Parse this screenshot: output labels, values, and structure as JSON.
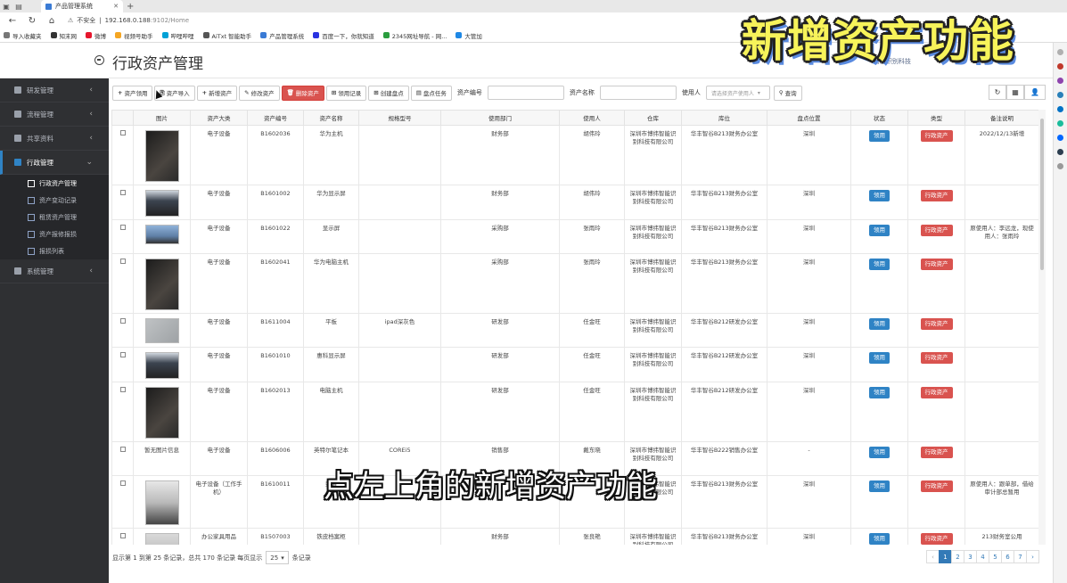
{
  "browser": {
    "tab_title": "产品管理系统",
    "address_warning": "不安全",
    "address_host": "192.168.0.188",
    "address_path": ":9102/Home",
    "bookmarks": [
      "导入收藏夹",
      "知末网",
      "微博",
      "视频号助手",
      "哔哩哔哩",
      "AiTxt 智能助手",
      "产品管理系统",
      "百度一下，你就知道",
      "2345网址导航 - 网...",
      "大管加"
    ]
  },
  "header": {
    "title": "行政资产管理",
    "company": "智能识别科技"
  },
  "sidebar": {
    "items": [
      {
        "label": "研发管理"
      },
      {
        "label": "流程管理"
      },
      {
        "label": "共享资料"
      },
      {
        "label": "行政管理"
      }
    ],
    "sub_items": [
      {
        "label": "行政资产管理"
      },
      {
        "label": "资产变动记录"
      },
      {
        "label": "租赁资产管理"
      },
      {
        "label": "资产报修报损"
      },
      {
        "label": "报损列表"
      }
    ],
    "last_item": {
      "label": "系统管理"
    }
  },
  "toolbar": {
    "buttons": [
      "资产领用",
      "资产导入",
      "新增资产",
      "修改资产",
      "删除资产",
      "领用记录",
      "创建盘点",
      "盘点任务"
    ],
    "label_code": "资产编号",
    "label_name": "资产名称",
    "label_user": "使用人",
    "user_placeholder": "请选择资产使用人",
    "query": "查询"
  },
  "table": {
    "headers": [
      "",
      "图片",
      "资产大类",
      "资产编号",
      "资产名称",
      "规格型号",
      "使用部门",
      "使用人",
      "仓库",
      "库位",
      "盘点位置",
      "状态",
      "类型",
      "备注说明"
    ],
    "rows": [
      {
        "img": "",
        "category": "电子设备",
        "code": "B1602036",
        "name": "华为主机",
        "spec": "",
        "dept": "财务部",
        "user": "胡伟玲",
        "warehouse": "深圳市博纬智能识别科技有限公司",
        "location": "华丰智谷B213财务办公室",
        "check": "深圳",
        "status": "领用",
        "type": "行政资产",
        "note": "2022/12/13新增"
      },
      {
        "img": "",
        "category": "电子设备",
        "code": "B1601002",
        "name": "华为显示屏",
        "spec": "",
        "dept": "财务部",
        "user": "胡伟玲",
        "warehouse": "深圳市博纬智能识别科技有限公司",
        "location": "华丰智谷B213财务办公室",
        "check": "深圳",
        "status": "领用",
        "type": "行政资产",
        "note": ""
      },
      {
        "img": "",
        "category": "电子设备",
        "code": "B1601022",
        "name": "显示屏",
        "spec": "",
        "dept": "采购部",
        "user": "张雨玲",
        "warehouse": "深圳市博纬智能识别科技有限公司",
        "location": "华丰智谷B213财务办公室",
        "check": "深圳",
        "status": "领用",
        "type": "行政资产",
        "note": "原使用人：李远龙，现使用人：张雨玲"
      },
      {
        "img": "",
        "category": "电子设备",
        "code": "B1602041",
        "name": "华为电脑主机",
        "spec": "",
        "dept": "采购部",
        "user": "张雨玲",
        "warehouse": "深圳市博纬智能识别科技有限公司",
        "location": "华丰智谷B213财务办公室",
        "check": "深圳",
        "status": "领用",
        "type": "行政资产",
        "note": ""
      },
      {
        "img": "",
        "category": "电子设备",
        "code": "B1611004",
        "name": "平板",
        "spec": "ipad深灰色",
        "dept": "研发部",
        "user": "任金旺",
        "warehouse": "深圳市博纬智能识别科技有限公司",
        "location": "华丰智谷B212研发办公室",
        "check": "深圳",
        "status": "领用",
        "type": "行政资产",
        "note": ""
      },
      {
        "img": "",
        "category": "电子设备",
        "code": "B1601010",
        "name": "惠科显示屏",
        "spec": "",
        "dept": "研发部",
        "user": "任金旺",
        "warehouse": "深圳市博纬智能识别科技有限公司",
        "location": "华丰智谷B212研发办公室",
        "check": "深圳",
        "status": "领用",
        "type": "行政资产",
        "note": ""
      },
      {
        "img": "",
        "category": "电子设备",
        "code": "B1602013",
        "name": "电脑主机",
        "spec": "",
        "dept": "研发部",
        "user": "任金旺",
        "warehouse": "深圳市博纬智能识别科技有限公司",
        "location": "华丰智谷B212研发办公室",
        "check": "深圳",
        "status": "领用",
        "type": "行政资产",
        "note": ""
      },
      {
        "img": "暂无图片信息",
        "category": "电子设备",
        "code": "B1606006",
        "name": "英特尔笔记本",
        "spec": "COREi5",
        "dept": "销售部",
        "user": "戴东晓",
        "warehouse": "深圳市博纬智能识别科技有限公司",
        "location": "华丰智谷B222销售办公室",
        "check": "-",
        "status": "领用",
        "type": "行政资产",
        "note": ""
      },
      {
        "img": "",
        "category": "电子设备（工作手机）",
        "code": "B1610011",
        "name": "荣耀",
        "spec": "",
        "dept": "",
        "user": "",
        "warehouse": "深圳市博纬智能识别科技有限公司",
        "location": "华丰智谷B213财务办公室",
        "check": "深圳",
        "status": "领用",
        "type": "行政资产",
        "note": "原使用人：跟单部，借给审计部总暂用"
      },
      {
        "img": "",
        "category": "办公家具用品",
        "code": "B1507003",
        "name": "铁皮档案柜",
        "spec": "",
        "dept": "财务部",
        "user": "张良艳",
        "warehouse": "深圳市博纬智能识别科技有限公司",
        "location": "华丰智谷B213财务办公室",
        "check": "深圳",
        "status": "领用",
        "type": "行政资产",
        "note": "213财务室公用"
      }
    ]
  },
  "footer": {
    "summary": "显示第 1 到第 25 条记录，总共 170 条记录 每页显示",
    "page_size": "25",
    "suffix": "条记录",
    "pages": [
      "‹",
      "1",
      "2",
      "3",
      "4",
      "5",
      "6",
      "7",
      "›"
    ]
  },
  "overlay": {
    "banner": "新增资产功能",
    "subtitle": "点左上角的新增资产功能"
  },
  "colors": {
    "sidebar_bg": "#2f3033",
    "status_blue": "#2f83c5",
    "type_red": "#d9534f",
    "banner_yellow": "#f7f35a"
  }
}
